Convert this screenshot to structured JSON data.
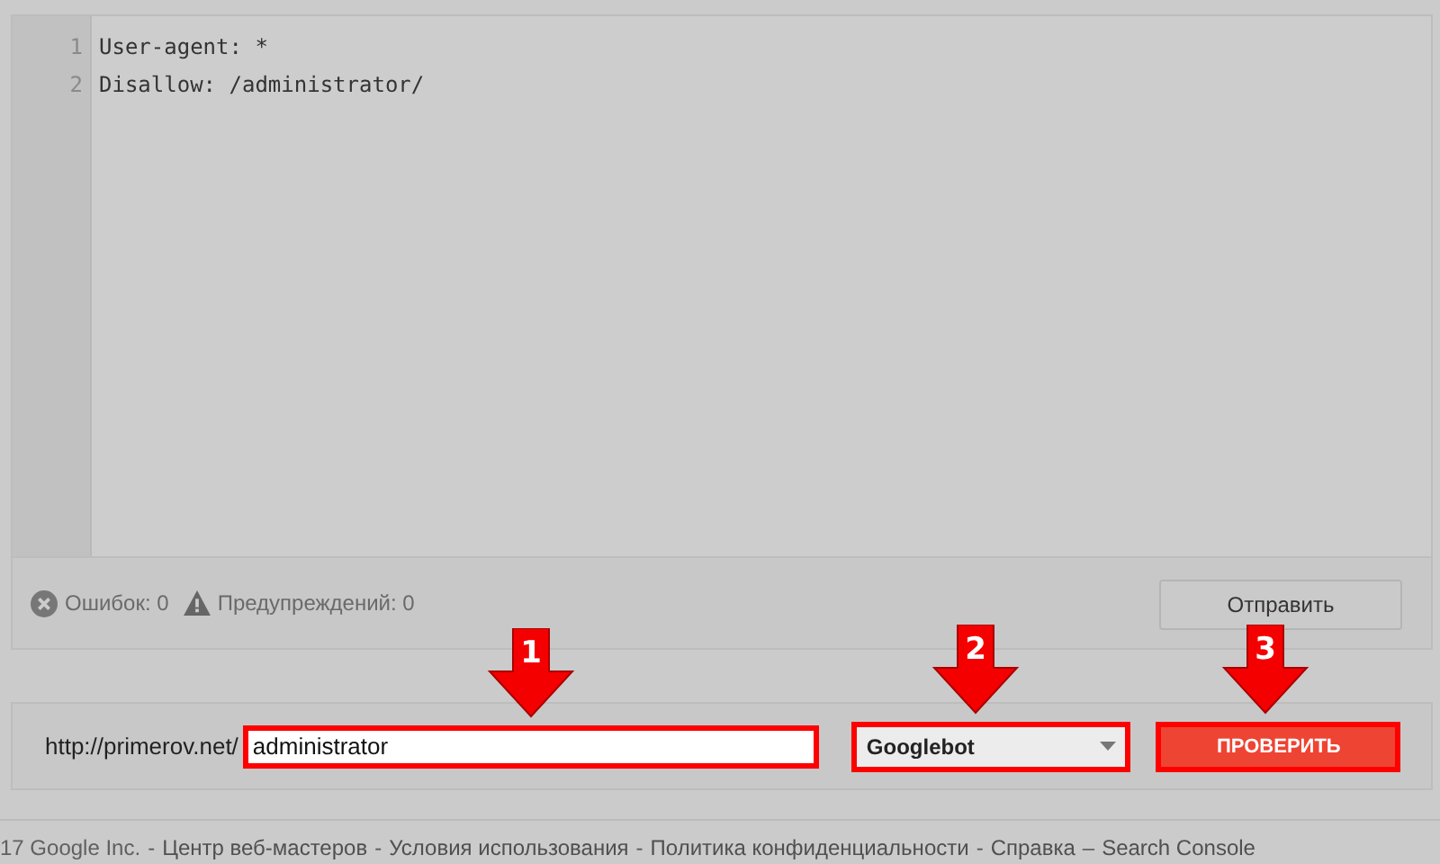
{
  "editor": {
    "lines": [
      {
        "number": "1",
        "text": "User-agent: *"
      },
      {
        "number": "2",
        "text": "Disallow: /administrator/"
      }
    ]
  },
  "status": {
    "errors": "Ошибок: 0",
    "warnings": "Предупреждений: 0",
    "submit": "Отправить"
  },
  "test": {
    "prefix": "http://primerov.net/",
    "path": {
      "value": "administrator",
      "annotation": "1"
    },
    "agent": {
      "value": "Googlebot",
      "annotation": "2"
    },
    "button": {
      "label": "ПРОВЕРИТЬ",
      "annotation": "3"
    }
  },
  "footer": [
    {
      "kind": "text",
      "text": "17 Google Inc."
    },
    {
      "kind": "separator",
      "text": "-"
    },
    {
      "kind": "link",
      "text": "Центр веб-мастеров"
    },
    {
      "kind": "separator",
      "text": "-"
    },
    {
      "kind": "link",
      "text": "Условия использования"
    },
    {
      "kind": "separator",
      "text": "-"
    },
    {
      "kind": "link",
      "text": "Политика конфиденциальности"
    },
    {
      "kind": "separator",
      "text": "-"
    },
    {
      "kind": "link",
      "text": "Справка"
    },
    {
      "kind": "separator",
      "text": "–"
    },
    {
      "kind": "link",
      "text": "Search Console"
    }
  ]
}
